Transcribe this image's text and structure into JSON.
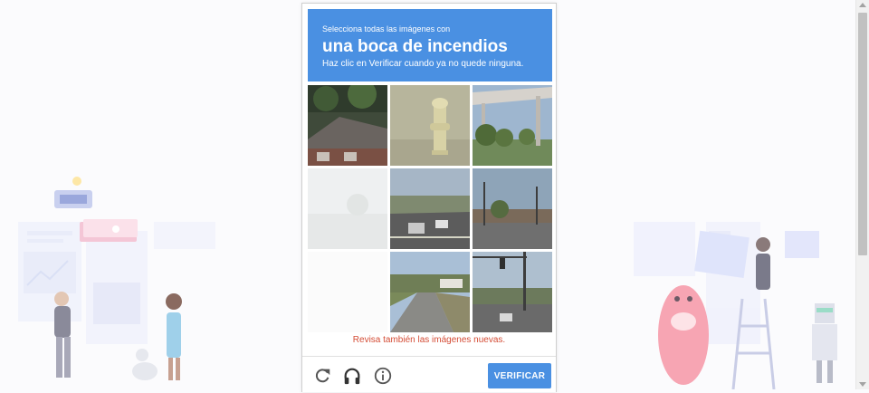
{
  "captcha": {
    "instruction_line1": "Selecciona todas las imágenes con",
    "target_object": "una boca de incendios",
    "instruction_line3": "Haz clic en Verificar cuando ya no quede ninguna.",
    "error_message": "Revisa también las imágenes nuevas.",
    "verify_label": "VERIFICAR",
    "tiles": [
      {
        "scene": "house-roof"
      },
      {
        "scene": "fire-hydrant"
      },
      {
        "scene": "highway-overpass"
      },
      {
        "scene": "faded-blank"
      },
      {
        "scene": "city-road-traffic"
      },
      {
        "scene": "street-poles"
      },
      {
        "scene": "blank"
      },
      {
        "scene": "rural-road"
      },
      {
        "scene": "intersection-traffic-light"
      }
    ],
    "icons": [
      "reload-icon",
      "headphones-icon",
      "info-icon"
    ],
    "accent_color": "#4a90e2",
    "error_color": "#d44c35"
  }
}
